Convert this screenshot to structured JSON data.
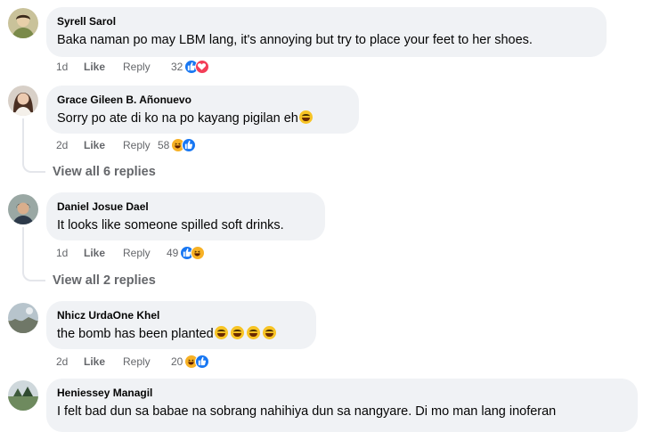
{
  "comments": [
    {
      "author": "Syrell Sarol",
      "text": "Baka naman po may LBM lang, it's annoying but try to place your feet to her shoes.",
      "time": "1d",
      "like_label": "Like",
      "reply_label": "Reply",
      "reaction_count": "32",
      "reactions": [
        "like",
        "love"
      ]
    },
    {
      "author": "Grace Gileen B. Añonuevo",
      "text": "Sorry po ate di ko na po kayang pigilan eh",
      "time": "2d",
      "like_label": "Like",
      "reply_label": "Reply",
      "reaction_count": "58",
      "reactions": [
        "haha",
        "like"
      ],
      "view_replies": "View all 6 replies"
    },
    {
      "author": "Daniel Josue Dael",
      "text": "It looks like someone spilled soft drinks.",
      "time": "1d",
      "like_label": "Like",
      "reply_label": "Reply",
      "reaction_count": "49",
      "reactions": [
        "like",
        "haha"
      ],
      "view_replies": "View all 2 replies"
    },
    {
      "author": "Nhicz UrdaOne Khel",
      "text": "the bomb has been planted",
      "time": "2d",
      "like_label": "Like",
      "reply_label": "Reply",
      "reaction_count": "20",
      "reactions": [
        "haha",
        "like"
      ]
    },
    {
      "author": "Heniessey Managil",
      "text": "I felt bad dun sa babae na sobrang nahihiya dun sa nangyare. Di mo man lang inoferan"
    }
  ],
  "icons": {
    "like": "like-reaction-icon",
    "love": "love-reaction-icon",
    "haha": "haha-reaction-icon",
    "emoji": "laughing-tears-emoji"
  },
  "colors": {
    "bubble": "#f0f2f5",
    "meta_text": "#65676b",
    "like_blue": "#1877f2",
    "love_red": "#f33e58",
    "haha_yellow": "#f7b125"
  }
}
